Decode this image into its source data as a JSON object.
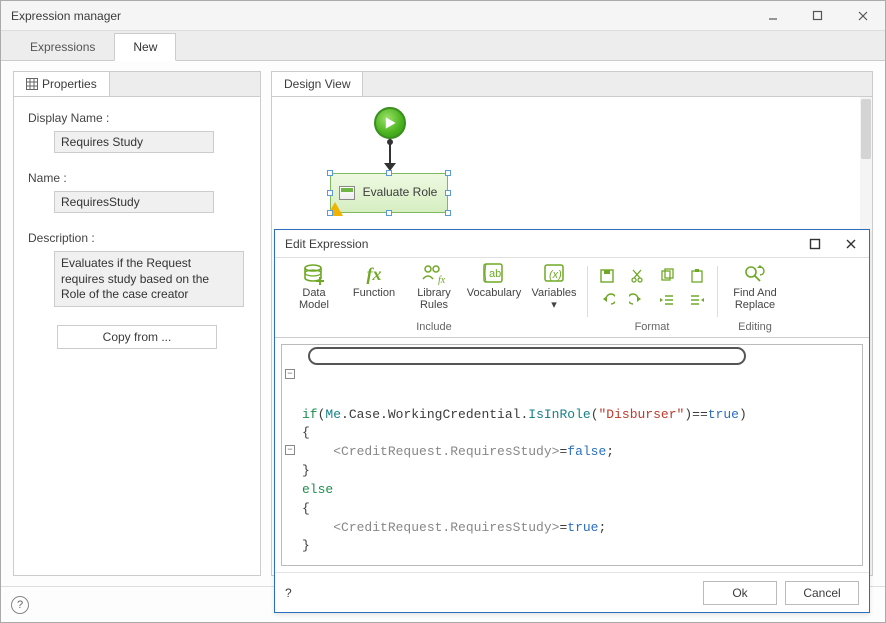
{
  "window": {
    "title": "Expression manager"
  },
  "tabs": {
    "expressions": "Expressions",
    "new": "New"
  },
  "leftPanel": {
    "header": "Properties",
    "displayName": {
      "label": "Display Name :",
      "value": "Requires Study"
    },
    "name": {
      "label": "Name :",
      "value": "RequiresStudy"
    },
    "description": {
      "label": "Description :",
      "value": "Evaluates if the Request requires study based on the Role of the case creator"
    },
    "copyFrom": "Copy from ..."
  },
  "rightPanel": {
    "header": "Design View",
    "evalNode": "Evaluate Role"
  },
  "dialog": {
    "title": "Edit Expression",
    "ribbon": {
      "dataModel": "Data Model",
      "function": "Function",
      "libraryRules": "Library Rules",
      "vocabulary": "Vocabulary",
      "variables": "Variables",
      "groupInclude": "Include",
      "groupFormat": "Format",
      "findReplace": "Find And Replace",
      "groupEditing": "Editing"
    },
    "code": {
      "if": "if",
      "expr_prefix": "Me",
      "expr_path": ".Case.WorkingCredential.",
      "expr_fn": "IsInRole",
      "expr_str": "\"Disburser\"",
      "expr_eq": "==",
      "expr_true": "true",
      "l2": "{",
      "l3a": "<CreditRequest.RequiresStudy>",
      "l3eq": "=",
      "l3v": "false",
      "l3s": ";",
      "l4": "}",
      "else": "else",
      "l6": "{",
      "l7v": "true",
      "l8": "}"
    },
    "ok": "Ok",
    "cancel": "Cancel"
  }
}
